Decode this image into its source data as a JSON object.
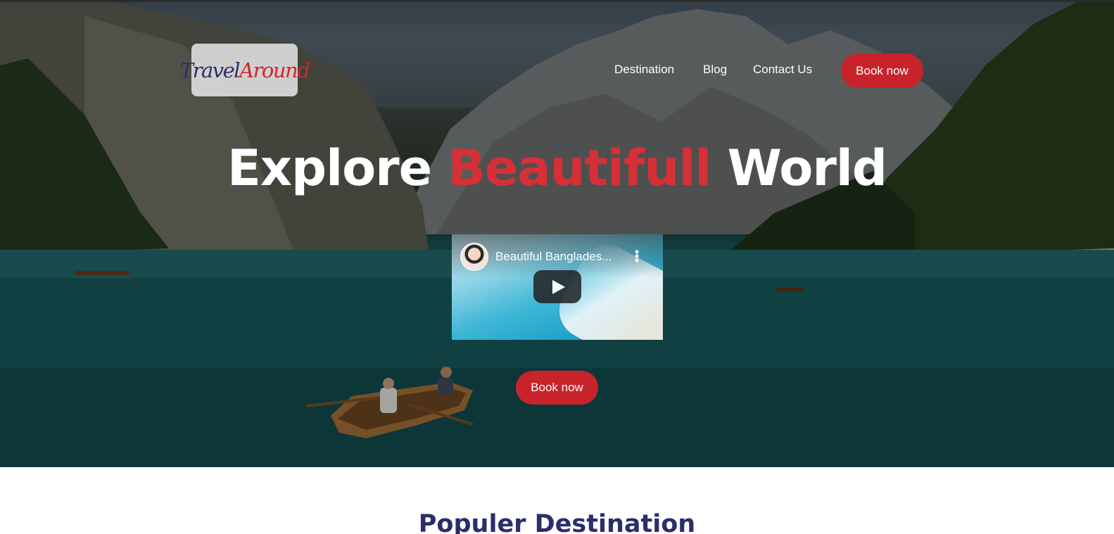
{
  "brand": {
    "logo_part1": "Travel",
    "logo_part2": "Around"
  },
  "nav": {
    "items": [
      {
        "label": "Destination"
      },
      {
        "label": "Blog"
      },
      {
        "label": "Contact Us"
      }
    ],
    "cta_label": "Book now"
  },
  "hero": {
    "headline_part1": "Explore",
    "headline_accent": "Beautifull",
    "headline_part2": "World",
    "cta_label": "Book now"
  },
  "video": {
    "title": "Beautiful Banglades..."
  },
  "sections": {
    "popular_title": "Populer Destination"
  },
  "colors": {
    "accent": "#c8232b",
    "heading_navy": "#2b2e6b",
    "headline_red": "#d63036"
  }
}
